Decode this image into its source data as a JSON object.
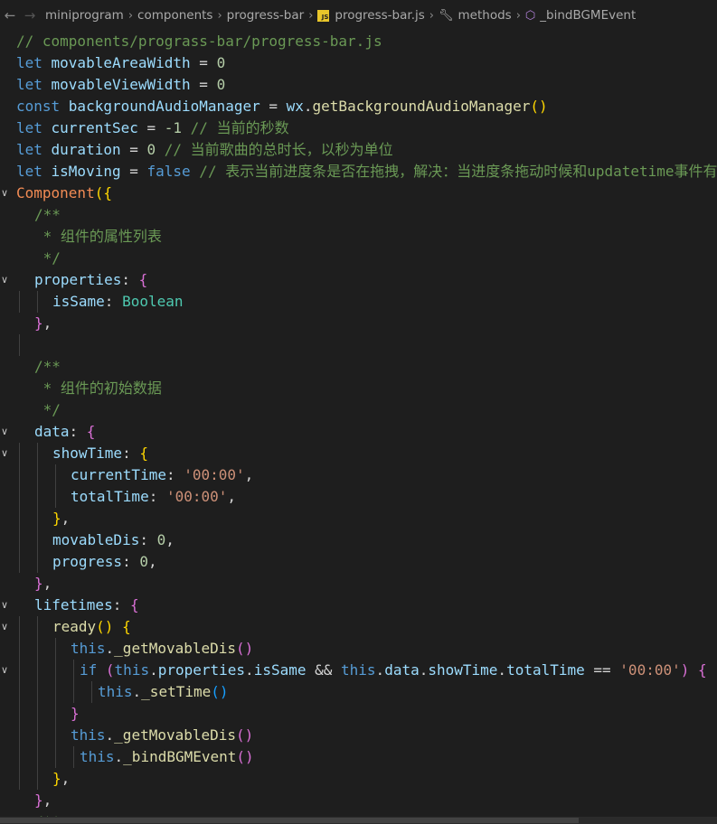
{
  "breadcrumb": {
    "segments": [
      "miniprogram",
      "components",
      "progress-bar",
      "progress-bar.js",
      "methods",
      "_bindBGMEvent"
    ],
    "file_icon_text": "JS"
  },
  "editor": {
    "lines": [
      {
        "indent": 0,
        "tokens": [
          [
            "cm",
            "// components/prograss-bar/progress-bar.js"
          ]
        ]
      },
      {
        "indent": 0,
        "tokens": [
          [
            "kw",
            "let "
          ],
          [
            "var",
            "movableAreaWidth"
          ],
          [
            "pn",
            " = "
          ],
          [
            "num",
            "0"
          ]
        ]
      },
      {
        "indent": 0,
        "tokens": [
          [
            "kw",
            "let "
          ],
          [
            "var",
            "movableViewWidth"
          ],
          [
            "pn",
            " = "
          ],
          [
            "num",
            "0"
          ]
        ]
      },
      {
        "indent": 0,
        "tokens": [
          [
            "kw",
            "const "
          ],
          [
            "var",
            "backgroundAudioManager"
          ],
          [
            "pn",
            " = "
          ],
          [
            "var",
            "wx"
          ],
          [
            "pn",
            "."
          ],
          [
            "fn",
            "getBackgroundAudioManager"
          ],
          [
            "b1",
            "()"
          ]
        ]
      },
      {
        "indent": 0,
        "tokens": [
          [
            "kw",
            "let "
          ],
          [
            "var",
            "currentSec"
          ],
          [
            "pn",
            " = "
          ],
          [
            "num",
            "-1"
          ],
          [
            "cm",
            " // 当前的秒数"
          ]
        ]
      },
      {
        "indent": 0,
        "tokens": [
          [
            "kw",
            "let "
          ],
          [
            "var",
            "duration"
          ],
          [
            "pn",
            " = "
          ],
          [
            "num",
            "0"
          ],
          [
            "cm",
            " // 当前歌曲的总时长，以秒为单位"
          ]
        ]
      },
      {
        "indent": 0,
        "tokens": [
          [
            "kw",
            "let "
          ],
          [
            "var",
            "isMoving"
          ],
          [
            "pn",
            " = "
          ],
          [
            "kw",
            "false"
          ],
          [
            "cm",
            " // 表示当前进度条是否在拖拽，解决：当进度条拖动时候和updatetime事件有冲突的问题"
          ]
        ]
      },
      {
        "indent": 0,
        "fold": true,
        "tokens": [
          [
            "oc",
            "Component"
          ],
          [
            "b1",
            "({"
          ]
        ]
      },
      {
        "indent": 2,
        "tokens": [
          [
            "cm",
            "/**"
          ]
        ]
      },
      {
        "indent": 2,
        "tokens": [
          [
            "cm",
            " * 组件的属性列表"
          ]
        ]
      },
      {
        "indent": 2,
        "tokens": [
          [
            "cm",
            " */"
          ]
        ]
      },
      {
        "indent": 2,
        "fold": true,
        "tokens": [
          [
            "var",
            "properties"
          ],
          [
            "pn",
            ": "
          ],
          [
            "b2",
            "{"
          ]
        ]
      },
      {
        "indent": 4,
        "tokens": [
          [
            "var",
            "isSame"
          ],
          [
            "pn",
            ": "
          ],
          [
            "ty",
            "Boolean"
          ]
        ]
      },
      {
        "indent": 2,
        "tokens": [
          [
            "b2",
            "}"
          ],
          [
            "pn",
            ","
          ]
        ]
      },
      {
        "indent": 2,
        "tokens": []
      },
      {
        "indent": 2,
        "tokens": [
          [
            "cm",
            "/**"
          ]
        ]
      },
      {
        "indent": 2,
        "tokens": [
          [
            "cm",
            " * 组件的初始数据"
          ]
        ]
      },
      {
        "indent": 2,
        "tokens": [
          [
            "cm",
            " */"
          ]
        ]
      },
      {
        "indent": 2,
        "fold": true,
        "tokens": [
          [
            "var",
            "data"
          ],
          [
            "pn",
            ": "
          ],
          [
            "b2",
            "{"
          ]
        ]
      },
      {
        "indent": 4,
        "fold": true,
        "tokens": [
          [
            "var",
            "showTime"
          ],
          [
            "pn",
            ": "
          ],
          [
            "b1",
            "{"
          ]
        ]
      },
      {
        "indent": 6,
        "tokens": [
          [
            "var",
            "currentTime"
          ],
          [
            "pn",
            ": "
          ],
          [
            "str",
            "'00:00'"
          ],
          [
            "pn",
            ","
          ]
        ]
      },
      {
        "indent": 6,
        "tokens": [
          [
            "var",
            "totalTime"
          ],
          [
            "pn",
            ": "
          ],
          [
            "str",
            "'00:00'"
          ],
          [
            "pn",
            ","
          ]
        ]
      },
      {
        "indent": 4,
        "tokens": [
          [
            "b1",
            "}"
          ],
          [
            "pn",
            ","
          ]
        ]
      },
      {
        "indent": 4,
        "tokens": [
          [
            "var",
            "movableDis"
          ],
          [
            "pn",
            ": "
          ],
          [
            "num",
            "0"
          ],
          [
            "pn",
            ","
          ]
        ]
      },
      {
        "indent": 4,
        "tokens": [
          [
            "var",
            "progress"
          ],
          [
            "pn",
            ": "
          ],
          [
            "num",
            "0"
          ],
          [
            "pn",
            ","
          ]
        ]
      },
      {
        "indent": 2,
        "tokens": [
          [
            "b2",
            "}"
          ],
          [
            "pn",
            ","
          ]
        ]
      },
      {
        "indent": 2,
        "fold": true,
        "tokens": [
          [
            "var",
            "lifetimes"
          ],
          [
            "pn",
            ": "
          ],
          [
            "b2",
            "{"
          ]
        ]
      },
      {
        "indent": 4,
        "fold": true,
        "tokens": [
          [
            "fn",
            "ready"
          ],
          [
            "b1",
            "()"
          ],
          [
            "pn",
            " "
          ],
          [
            "b1",
            "{"
          ]
        ]
      },
      {
        "indent": 6,
        "tokens": [
          [
            "kw",
            "this"
          ],
          [
            "pn",
            "."
          ],
          [
            "fn",
            "_getMovableDis"
          ],
          [
            "b2",
            "()"
          ]
        ]
      },
      {
        "indent": 7,
        "fold": true,
        "tokens": [
          [
            "kw",
            "if "
          ],
          [
            "b2",
            "("
          ],
          [
            "kw",
            "this"
          ],
          [
            "pn",
            "."
          ],
          [
            "var",
            "properties"
          ],
          [
            "pn",
            "."
          ],
          [
            "var",
            "isSame"
          ],
          [
            "pn",
            " && "
          ],
          [
            "kw",
            "this"
          ],
          [
            "pn",
            "."
          ],
          [
            "var",
            "data"
          ],
          [
            "pn",
            "."
          ],
          [
            "var",
            "showTime"
          ],
          [
            "pn",
            "."
          ],
          [
            "var",
            "totalTime"
          ],
          [
            "pn",
            " == "
          ],
          [
            "str",
            "'00:00'"
          ],
          [
            "b2",
            ")"
          ],
          [
            "pn",
            " "
          ],
          [
            "b2",
            "{"
          ]
        ]
      },
      {
        "indent": 9,
        "tokens": [
          [
            "kw",
            "this"
          ],
          [
            "pn",
            "."
          ],
          [
            "fn",
            "_setTime"
          ],
          [
            "b3",
            "()"
          ]
        ]
      },
      {
        "indent": 6,
        "tokens": [
          [
            "b2",
            "}"
          ]
        ]
      },
      {
        "indent": 6,
        "tokens": [
          [
            "kw",
            "this"
          ],
          [
            "pn",
            "."
          ],
          [
            "fn",
            "_getMovableDis"
          ],
          [
            "b2",
            "()"
          ]
        ]
      },
      {
        "indent": 7,
        "tokens": [
          [
            "kw",
            "this"
          ],
          [
            "pn",
            "."
          ],
          [
            "fn",
            "_bindBGMEvent"
          ],
          [
            "b2",
            "()"
          ]
        ]
      },
      {
        "indent": 4,
        "tokens": [
          [
            "b1",
            "}"
          ],
          [
            "pn",
            ","
          ]
        ]
      },
      {
        "indent": 2,
        "tokens": [
          [
            "b2",
            "}"
          ],
          [
            "pn",
            ","
          ]
        ]
      },
      {
        "indent": 2,
        "tokens": [
          [
            "cm",
            "/**"
          ]
        ]
      }
    ]
  }
}
